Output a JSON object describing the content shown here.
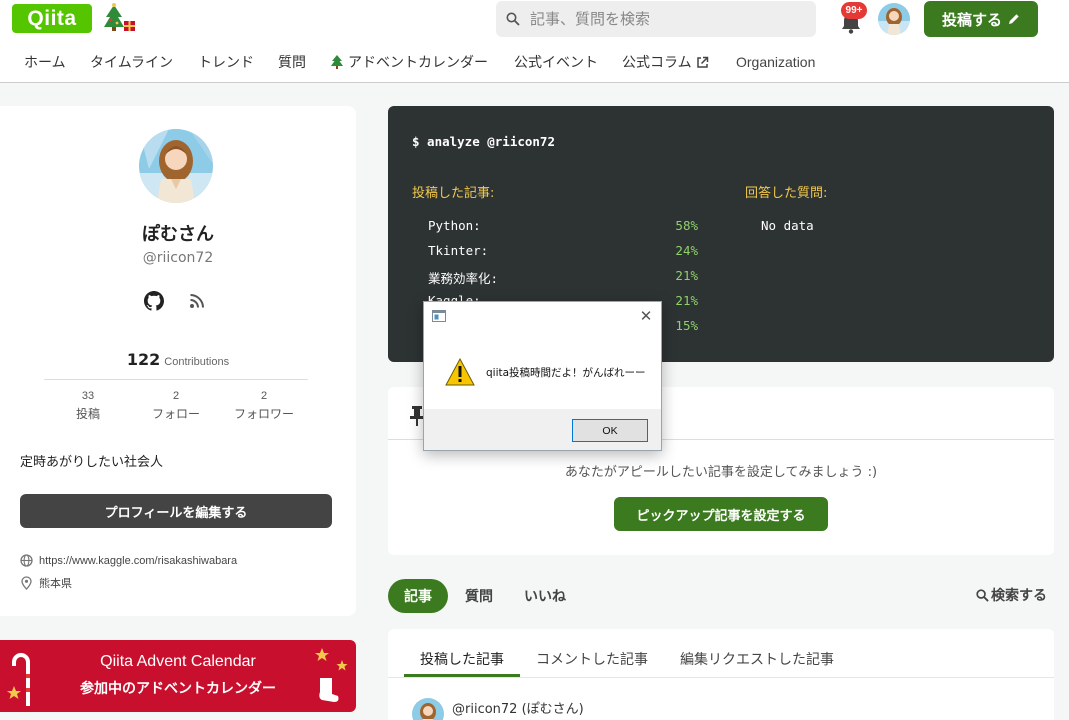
{
  "header": {
    "logo": "Qiita",
    "search_placeholder": "記事、質問を検索",
    "notification_badge": "99+",
    "post_button": "投稿する",
    "nav": [
      "ホーム",
      "タイムライン",
      "トレンド",
      "質問",
      "アドベントカレンダー",
      "公式イベント",
      "公式コラム",
      "Organization"
    ]
  },
  "profile": {
    "name": "ぽむさん",
    "handle": "@riicon72",
    "contributions_count": "122",
    "contributions_label": "Contributions",
    "stats": [
      {
        "num": "33",
        "label": "投稿"
      },
      {
        "num": "2",
        "label": "フォロー"
      },
      {
        "num": "2",
        "label": "フォロワー"
      }
    ],
    "bio": "定時あがりしたい社会人",
    "edit_button": "プロフィールを編集する",
    "website": "https://www.kaggle.com/risakashiwabara",
    "location": "熊本県"
  },
  "advent": {
    "title": "Qiita Advent Calendar",
    "subtitle": "参加中のアドベントカレンダー"
  },
  "terminal": {
    "command": "$ analyze @riicon72",
    "posted_heading": "投稿した記事:",
    "answered_heading": "回答した質問:",
    "languages": [
      {
        "name": "Python:",
        "pct": "58%"
      },
      {
        "name": "Tkinter:",
        "pct": "24%"
      },
      {
        "name": "業務効率化:",
        "pct": "21%"
      },
      {
        "name": "Kaggle:",
        "pct": "21%"
      },
      {
        "name": "",
        "pct": "15%"
      }
    ],
    "no_data": "No data"
  },
  "pinned": {
    "message": "あなたがアピールしたい記事を設定してみましょう :)",
    "button": "ピックアップ記事を設定する"
  },
  "tabs": {
    "main": [
      "記事",
      "質問",
      "いいね"
    ],
    "search": "検索する",
    "sub": [
      "投稿した記事",
      "コメントした記事",
      "編集リクエストした記事"
    ]
  },
  "article_item": {
    "author": "@riicon72 (ぽむさん)"
  },
  "dialog": {
    "message": "qiita投稿時間だよ！がんばれーー",
    "ok": "OK"
  },
  "colors": {
    "brand": "#55c500",
    "accent_green": "#3b7a1f",
    "terminal_bg": "#2d3233",
    "advent_red": "#c8102e"
  }
}
